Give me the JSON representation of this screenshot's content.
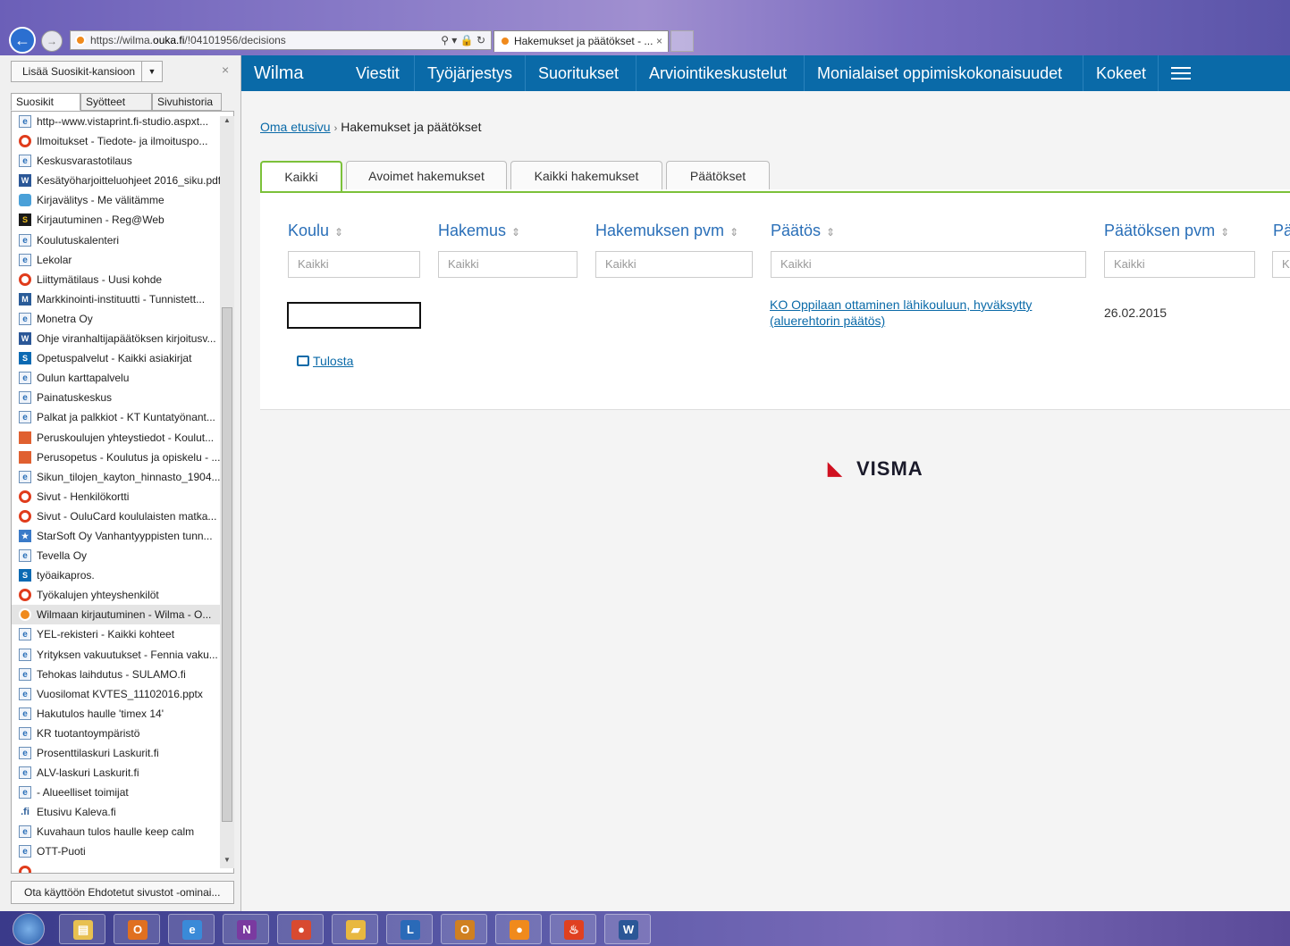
{
  "browser": {
    "url_prefix": "https://wilma.",
    "url_domain": "ouka.fi",
    "url_suffix": "/!04101956/decisions",
    "url_controls": "⚲ ▾ 🔒 ↻",
    "tab_title": "Hakemukset ja päätökset - ...",
    "tab_close": "×"
  },
  "favorites": {
    "add_button": "Lisää Suosikit-kansioon",
    "close": "×",
    "tabs": [
      "Suosikit",
      "Syötteet",
      "Sivuhistoria"
    ],
    "items": [
      {
        "label": "http--www.vistaprint.fi-studio.aspxt...",
        "icon": "ie"
      },
      {
        "label": "Ilmoitukset - Tiedote- ja ilmoituspo...",
        "icon": "ring"
      },
      {
        "label": "Keskusvarastotilaus",
        "icon": "ie"
      },
      {
        "label": "Kesätyöharjoitteluohjeet 2016_siku.pdf",
        "icon": "word"
      },
      {
        "label": "Kirjavälitys - Me välitämme",
        "icon": "book"
      },
      {
        "label": "Kirjautuminen - Reg@Web",
        "icon": "s"
      },
      {
        "label": "Koulutuskalenteri",
        "icon": "ie"
      },
      {
        "label": "Lekolar",
        "icon": "ie"
      },
      {
        "label": "Liittymätilaus - Uusi kohde",
        "icon": "ring"
      },
      {
        "label": "Markkinointi-instituutti - Tunnistett...",
        "icon": "mi"
      },
      {
        "label": "Monetra Oy",
        "icon": "ie"
      },
      {
        "label": "Ohje viranhaltijapäätöksen kirjoitusv...",
        "icon": "word"
      },
      {
        "label": "Opetuspalvelut - Kaikki asiakirjat",
        "icon": "sp"
      },
      {
        "label": "Oulun karttapalvelu",
        "icon": "ie"
      },
      {
        "label": "Painatuskeskus",
        "icon": "ie"
      },
      {
        "label": "Palkat ja palkkiot - KT Kuntatyönant...",
        "icon": "ie"
      },
      {
        "label": "Peruskoulujen yhteystiedot - Koulut...",
        "icon": "pk"
      },
      {
        "label": "Perusopetus - Koulutus ja opiskelu - ...",
        "icon": "pk"
      },
      {
        "label": "Sikun_tilojen_kayton_hinnasto_1904...",
        "icon": "ie"
      },
      {
        "label": "Sivut - Henkilökortti",
        "icon": "ring"
      },
      {
        "label": "Sivut - OuluCard koululaisten matka...",
        "icon": "ring"
      },
      {
        "label": "StarSoft Oy  Vanhantyyppisten tunn...",
        "icon": "star"
      },
      {
        "label": "Tevella Oy",
        "icon": "ie"
      },
      {
        "label": "työaikapros.",
        "icon": "sp"
      },
      {
        "label": "Työkalujen yhteyshenkilöt",
        "icon": "ring"
      },
      {
        "label": "Wilmaan kirjautuminen - Wilma - O...",
        "icon": "wilma",
        "selected": true
      },
      {
        "label": "YEL-rekisteri - Kaikki kohteet",
        "icon": "ie"
      },
      {
        "label": "Yrityksen vakuutukset - Fennia vaku...",
        "icon": "ie"
      },
      {
        "label": "Tehokas laihdutus - SULAMO.fi",
        "icon": "ie"
      },
      {
        "label": "Vuosilomat KVTES_11102016.pptx",
        "icon": "ie"
      },
      {
        "label": "Hakutulos haulle 'timex 14'",
        "icon": "ie"
      },
      {
        "label": "KR tuotantoympäristö",
        "icon": "ie"
      },
      {
        "label": "Prosenttilaskuri  Laskurit.fi",
        "icon": "ie"
      },
      {
        "label": "ALV-laskuri  Laskurit.fi",
        "icon": "ie"
      },
      {
        "label": "- Alueelliset toimijat",
        "icon": "ie"
      },
      {
        "label": "Etusivu  Kaleva.fi",
        "icon": "kal"
      },
      {
        "label": "Kuvahaun tulos haulle keep calm",
        "icon": "ie"
      },
      {
        "label": "OTT-Puoti",
        "icon": "ie"
      },
      {
        "label": "...",
        "icon": "ring"
      }
    ],
    "suggest_button": "Ota käyttöön Ehdotetut sivustot -ominai..."
  },
  "nav": {
    "brand": "Wilma",
    "items": [
      "Viestit",
      "Työjärjestys",
      "Suoritukset",
      "Arviointikeskustelut",
      "Monialaiset oppimiskokonaisuudet",
      "Kokeet"
    ]
  },
  "breadcrumb": {
    "home": "Oma etusivu",
    "separator": "›",
    "current": "Hakemukset ja päätökset"
  },
  "tabs": [
    "Kaikki",
    "Avoimet hakemukset",
    "Kaikki hakemukset",
    "Päätökset"
  ],
  "table": {
    "columns": [
      "Koulu",
      "Hakemus",
      "Hakemuksen pvm",
      "Päätös",
      "Päätöksen pvm",
      "Pä"
    ],
    "sort_glyph": "⇕",
    "filter_placeholder": "Kaikki",
    "filter_last": "K",
    "row": {
      "decision": "KO Oppilaan ottaminen lähikouluun, hyväksytty (aluerehtorin päätös)",
      "decision_date": "26.02.2015"
    }
  },
  "print_label": "Tulosta",
  "footer_logo": "VISMA",
  "taskbar": {
    "apps": [
      {
        "name": "explorer",
        "glyph": "▤",
        "color": "#e8c050"
      },
      {
        "name": "outlook-o",
        "glyph": "O",
        "color": "#e07020"
      },
      {
        "name": "ie",
        "glyph": "e",
        "color": "#3a8ad8"
      },
      {
        "name": "onenote",
        "glyph": "N",
        "color": "#7a3aa0"
      },
      {
        "name": "chrome",
        "glyph": "●",
        "color": "#d84a30"
      },
      {
        "name": "folder",
        "glyph": "▰",
        "color": "#e8b840"
      },
      {
        "name": "lync",
        "glyph": "L",
        "color": "#2a6ab8"
      },
      {
        "name": "outlook",
        "glyph": "O",
        "color": "#d08020"
      },
      {
        "name": "wilma",
        "glyph": "●",
        "color": "#f08a1c"
      },
      {
        "name": "java",
        "glyph": "♨",
        "color": "#e04020"
      },
      {
        "name": "word",
        "glyph": "W",
        "color": "#2b5797"
      }
    ]
  }
}
